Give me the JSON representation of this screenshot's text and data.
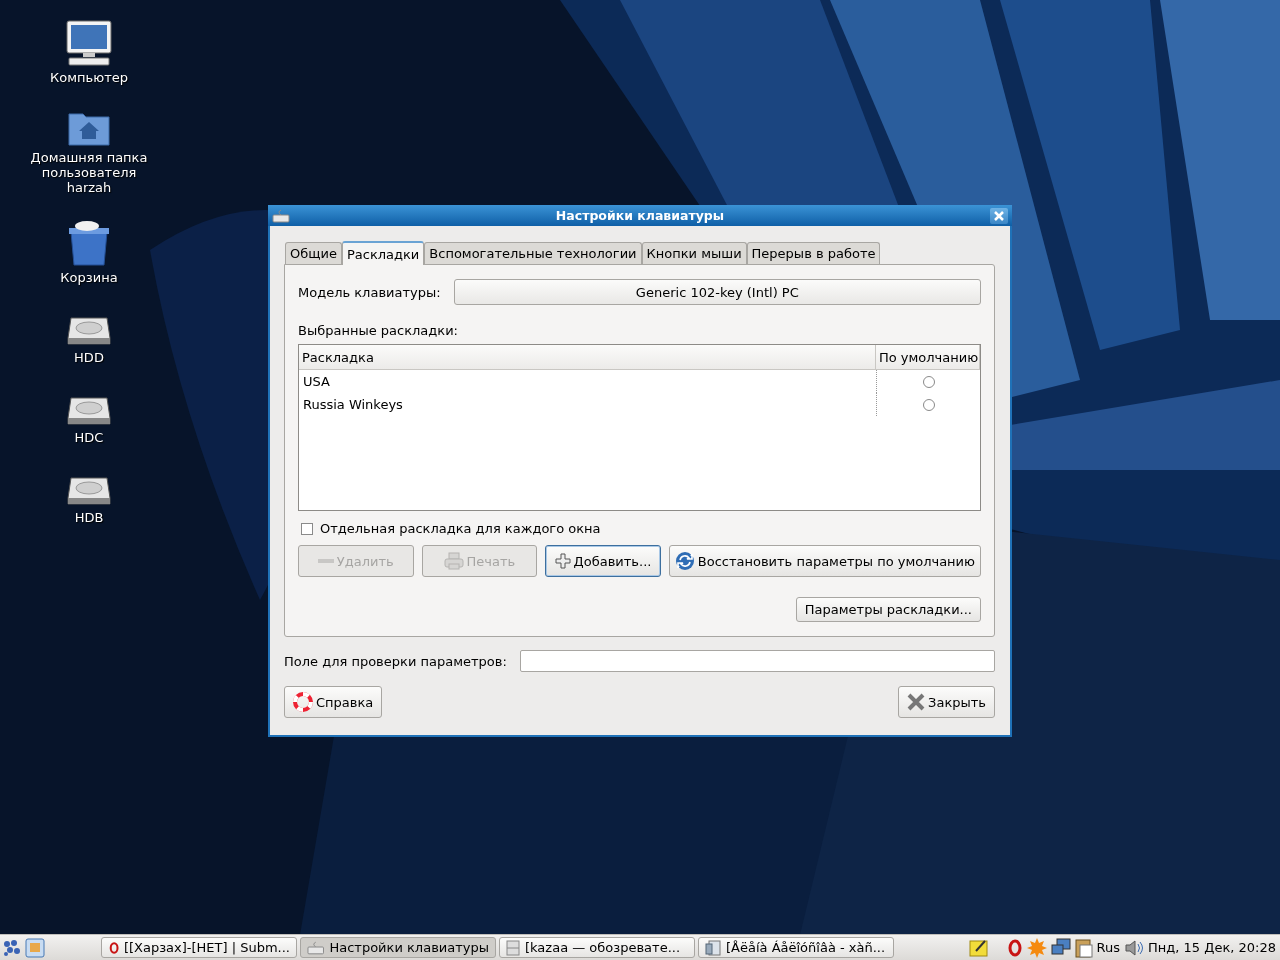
{
  "desktop_icons": [
    {
      "kind": "computer",
      "label": "Компьютер"
    },
    {
      "kind": "home",
      "label": "Домашняя папка пользователя harzah"
    },
    {
      "kind": "trash",
      "label": "Корзина"
    },
    {
      "kind": "drive",
      "label": "HDD"
    },
    {
      "kind": "drive",
      "label": "HDC"
    },
    {
      "kind": "drive",
      "label": "HDB"
    }
  ],
  "window": {
    "title": "Настройки клавиатуры",
    "tabs": [
      {
        "label": "Общие",
        "selected": false
      },
      {
        "label": "Раскладки",
        "selected": true
      },
      {
        "label": "Вспомогательные технологии",
        "selected": false
      },
      {
        "label": "Кнопки мыши",
        "selected": false
      },
      {
        "label": "Перерыв в работе",
        "selected": false
      }
    ],
    "model": {
      "label": "Модель клавиатуры:",
      "value": "Generic 102-key (Intl) PC"
    },
    "layouts_label": {
      "label": "Выбранные раскладки:"
    },
    "table": {
      "columns": [
        "Раскладка",
        "По умолчанию"
      ],
      "rows": [
        {
          "name": "USA",
          "selected": false
        },
        {
          "name": "Russia Winkeys",
          "selected": false
        }
      ]
    },
    "separate": {
      "label": "Отдельная раскладка для каждого окна",
      "checked": false
    },
    "buttons": [
      {
        "kind": "remove",
        "label": "Удалить",
        "disabled": true,
        "focused": false
      },
      {
        "kind": "print",
        "label": "Печать",
        "disabled": true,
        "focused": false
      },
      {
        "kind": "add",
        "label": "Добавить...",
        "disabled": false,
        "focused": true
      },
      {
        "kind": "reset",
        "label": "Восстановить параметры по умолчанию",
        "disabled": false,
        "focused": false
      }
    ],
    "options_button": {
      "label": "Параметры раскладки..."
    },
    "test_field": {
      "label": "Поле для проверки параметров:"
    },
    "help_button": {
      "label": "Справка"
    },
    "close_button": {
      "label": "Закрыть"
    }
  },
  "taskbar": {
    "tasks": [
      {
        "kind": "browser",
        "label": "[[Харзах]-[НЕТ] | Subm...",
        "selected": false
      },
      {
        "kind": "keyboard",
        "label": "Настройки клавиатуры",
        "selected": true
      },
      {
        "kind": "cabinet",
        "label": "[kazaa — обозревате...",
        "selected": false
      },
      {
        "kind": "document",
        "label": "[Åëåíà Áåëîóñîâà - xàñ...",
        "selected": false
      }
    ],
    "layout": "Rus",
    "clock": "Пнд, 15 Дек, 20:28"
  }
}
